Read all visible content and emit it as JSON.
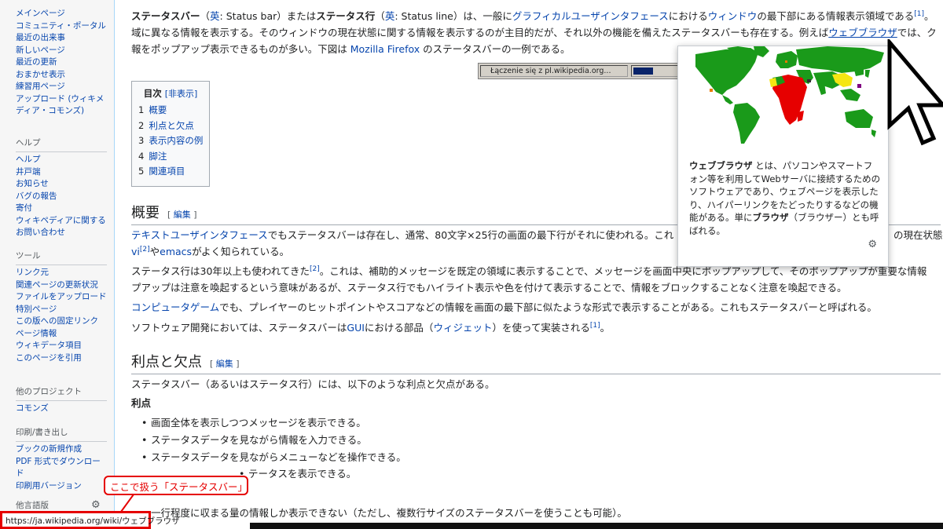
{
  "sidebar": {
    "nav_items": [
      "メインページ",
      "コミュニティ・ポータル",
      "最近の出来事",
      "新しいページ",
      "最近の更新",
      "おまかせ表示",
      "練習用ページ",
      "アップロード (ウィキメディア・コモンズ)"
    ],
    "help_heading": "ヘルプ",
    "help_items": [
      "ヘルプ",
      "井戸端",
      "お知らせ",
      "バグの報告",
      "寄付",
      "ウィキペディアに関するお問い合わせ"
    ],
    "tools_heading": "ツール",
    "tools_items": [
      "リンク元",
      "関連ページの更新状況",
      "ファイルをアップロード",
      "特別ページ",
      "この版への固定リンク",
      "ページ情報",
      "ウィキデータ項目",
      "このページを引用"
    ],
    "projects_heading": "他のプロジェクト",
    "projects_items": [
      "コモンズ"
    ],
    "print_heading": "印刷/書き出し",
    "print_items": [
      "ブックの新規作成",
      "PDF 形式でダウンロード",
      "印刷用バージョン"
    ],
    "lang_heading": "他言語版"
  },
  "intro": {
    "line1_term": "ステータスバー",
    "line1_paren_open": "（",
    "line1_en": "英",
    "line1_sb": ": Status bar）または",
    "line1_term2": "ステータス行",
    "line1_paren2": "（",
    "line1_en2": "英",
    "line1_sl": ": Status line）は、一般に",
    "line1_gui": "グラフィカルユーザインタフェース",
    "line1_mid": "における",
    "line1_window": "ウィンドウ",
    "line1_end": "の最下部にある情報表示領域である",
    "line1_ref": "[1]",
    "line1_tail": "。",
    "line2_a": "域に異なる情報を表示する。そのウィンドウの現在状態に関する情報を表示するのが主目的だが、それ以外の機能を備えたステータスバーも存在する。例えば",
    "line2_link": "ウェブブラウザ",
    "line2_b": "では、ク",
    "line3_a": "報をポップアップ表示できるものが多い。下図は ",
    "line3_link": "Mozilla Firefox",
    "line3_b": " のステータスバーの一例である。"
  },
  "statusbar_image": {
    "text": "Łączenie się z pl.wikipedia.org...",
    "progress": 0.45
  },
  "toc": {
    "title": "目次",
    "hide_label": "[非表示]",
    "items": [
      {
        "num": "1",
        "label": "概要"
      },
      {
        "num": "2",
        "label": "利点と欠点"
      },
      {
        "num": "3",
        "label": "表示内容の例"
      },
      {
        "num": "4",
        "label": "脚注"
      },
      {
        "num": "5",
        "label": "関連項目"
      }
    ]
  },
  "section_overview": {
    "heading": "概要",
    "edit_open": "[ ",
    "edit_label": "編集",
    "edit_close": " ]",
    "p1_link1": "テキストユーザインタフェース",
    "p1_a": "でもステータスバーは存在し、通常、80文字×25行の画面の最下行がそれに使われる。これ",
    "p1_tail_link": "の現在状態を",
    "p1b_vi": "vi",
    "p1b_ref": "[2]",
    "p1b_ya": "や",
    "p1b_emacs": "emacs",
    "p1b_b": "がよく知られている。",
    "p2_a": "ステータス行は30年以上も使われてきた",
    "p2_ref": "[2]",
    "p2_b": "。これは、補助的メッセージを既定の領域に表示することで、メッセージを画面中央にポップアップして、そのポップアップが重要な情報",
    "p2b": "プアップは注意を喚起するという意味があるが、ステータス行でもハイライト表示や色を付けて表示することで、情報をブロックすることなく注意を喚起できる。",
    "p3_link": "コンピュータゲーム",
    "p3_b": "でも、プレイヤーのヒットポイントやスコアなどの情報を画面の最下部に似たような形式で表示することがある。これもステータスバーと呼ばれる。",
    "p4_a": "ソフトウェア開発においては、ステータスバーは",
    "p4_gui": "GUI",
    "p4_b": "における部品（",
    "p4_widget": "ウィジェット",
    "p4_c": "）を使って実装される",
    "p4_ref": "[1]",
    "p4_d": "。"
  },
  "section_pros": {
    "heading": "利点と欠点",
    "edit_open": "[ ",
    "edit_label": "編集",
    "edit_close": " ]",
    "intro": "ステータスバー（あるいはステータス行）には、以下のような利点と欠点がある。",
    "pros_label": "利点",
    "pros": [
      "画面全体を表示しつつメッセージを表示できる。",
      "ステータスデータを見ながら情報を入力できる。",
      "ステータスデータを見ながらメニューなどを操作できる。"
    ],
    "pros4_tail": "テータスを表示できる。",
    "cons_first": "一行程度に収まる量の情報しか表示できない（ただし、複数行サイズのステータスバーを使うことも可能）。"
  },
  "popup": {
    "term": "ウェブブラウザ",
    "text_a": " とは、パソコンやスマートフォン等を利用してWebサーバに接続するためのソフトウェアであり、ウェブページを表示したり、ハイパーリンクをたどったりするなどの機能がある。単に",
    "term2": "ブラウザ",
    "text_b": "（ブラウザー）とも呼ばれる。"
  },
  "status_url": "https://ja.wikipedia.org/wiki/ウェブブラウザ",
  "annotation": "ここで扱う「ステータスバー」",
  "colors": {
    "link": "#0645ad",
    "annotation": "#e50000",
    "sidebar_bg": "#f6f6f6",
    "map_green": "#1a9a1a",
    "map_red": "#e60000",
    "map_yellow": "#f5e612"
  }
}
